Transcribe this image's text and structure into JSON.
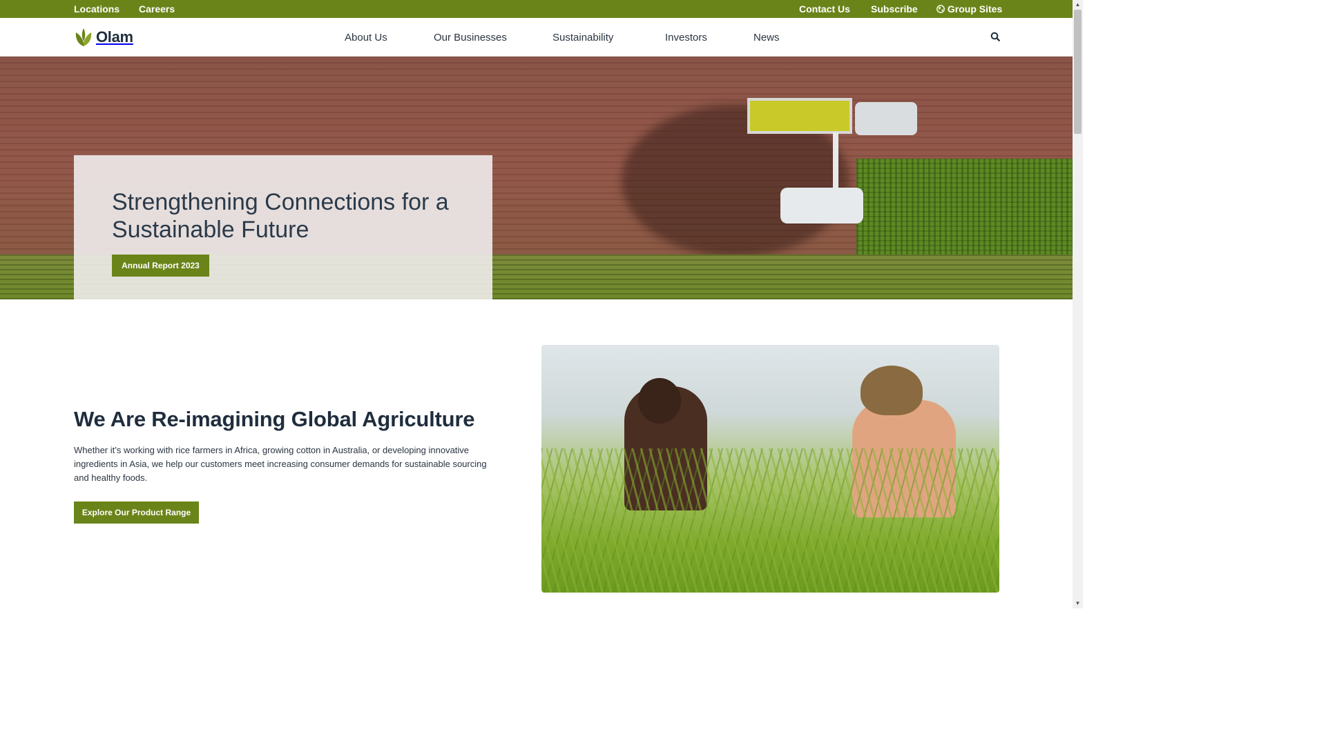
{
  "topbar": {
    "locations": "Locations",
    "careers": "Careers",
    "contact_us": "Contact Us",
    "subscribe": "Subscribe",
    "group_sites": "Group Sites"
  },
  "header": {
    "logo_text": "Olam",
    "nav": [
      "About Us",
      "Our Businesses",
      "Sustainability",
      "Investors",
      "News"
    ],
    "search_icon": "search-icon"
  },
  "hero": {
    "title": "Strengthening Connections for a Sustainable Future",
    "button_label": "Annual Report 2023"
  },
  "intro": {
    "title": "We Are Re-imagining Global Agriculture",
    "text": "Whether it’s working with rice farmers in Africa, growing cotton in Australia, or developing innovative ingredients in Asia, we help our customers meet increasing consumer demands for sustainable sourcing and healthy foods.",
    "button_label": "Explore Our Product Range"
  },
  "colors": {
    "brand_green": "#6b8419",
    "text_dark": "#1f2d3d"
  }
}
